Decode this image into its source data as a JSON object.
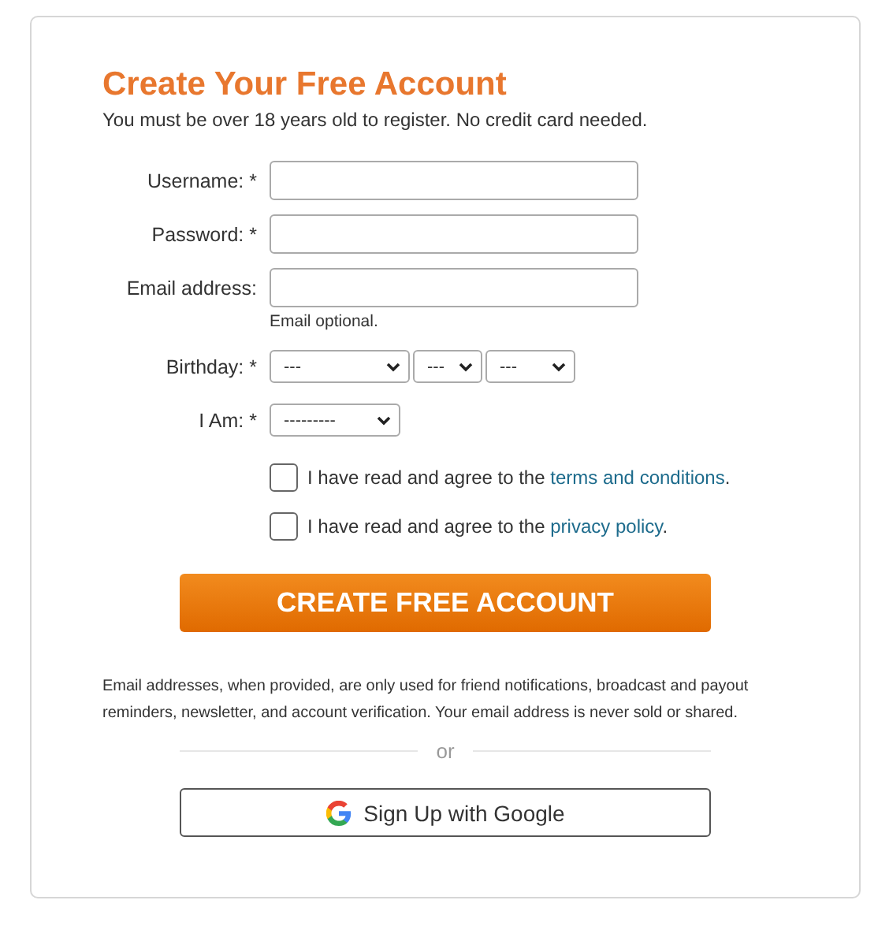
{
  "title": "Create Your Free Account",
  "subtitle": "You must be over 18 years old to register. No credit card needed.",
  "fields": [
    {
      "kind": "text",
      "label": "Username: *"
    },
    {
      "kind": "password",
      "label": "Password: *"
    },
    {
      "kind": "text",
      "label": "Email address:",
      "hint": "Email optional."
    },
    {
      "kind": "selects",
      "label": "Birthday: *",
      "selects": [
        "---",
        "---",
        "---"
      ]
    },
    {
      "kind": "selects",
      "label": "I Am: *",
      "selects": [
        "---------"
      ]
    }
  ],
  "agreements": [
    {
      "text": "I have read and agree to the ",
      "link": "terms and conditions",
      "suffix": ".",
      "checked": false
    },
    {
      "text": "I have read and agree to the ",
      "link": "privacy policy",
      "suffix": ".",
      "checked": false
    }
  ],
  "submit": "CREATE FREE ACCOUNT",
  "disclaimer": "Email addresses, when provided, are only used for friend notifications, broadcast and payout reminders, newsletter, and account verification. Your email address is never sold or shared.",
  "divider": "or",
  "google_button": "Sign Up with Google"
}
